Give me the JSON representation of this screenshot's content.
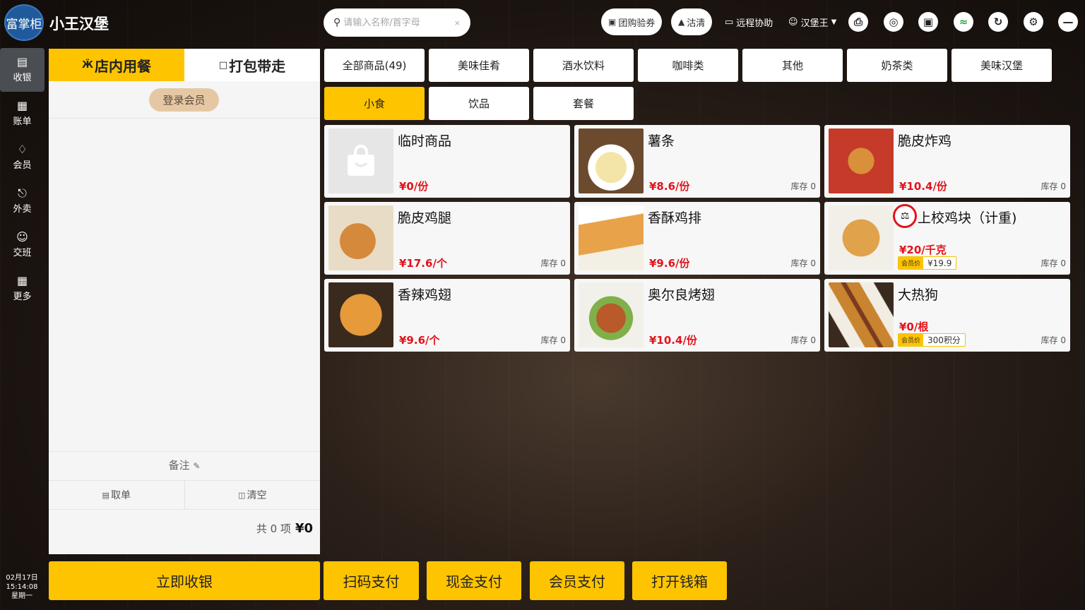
{
  "header": {
    "logo_text": "富掌柜",
    "shop_name": "小王汉堡",
    "search_placeholder": "请输入名称/首字母",
    "group_buy": "团购验券",
    "clean": "沽清",
    "remote": "远程协助",
    "user": "汉堡王"
  },
  "sidebar": {
    "items": [
      {
        "label": "收银",
        "icon": "cashier-icon"
      },
      {
        "label": "账单",
        "icon": "bill-icon"
      },
      {
        "label": "会员",
        "icon": "member-icon"
      },
      {
        "label": "外卖",
        "icon": "delivery-icon"
      },
      {
        "label": "交班",
        "icon": "shift-icon"
      },
      {
        "label": "更多",
        "icon": "more-icon"
      }
    ],
    "date": "02月17日",
    "time": "15:14:08",
    "weekday": "星期一"
  },
  "order": {
    "tab_dine": "店内用餐",
    "tab_takeout": "打包带走",
    "login_member": "登录会员",
    "note": "备注",
    "take_order": "取单",
    "clear": "清空",
    "count_text": "共 0 项",
    "total": "¥0"
  },
  "categories": {
    "row1": [
      "全部商品(49)",
      "美味佳肴",
      "酒水饮料",
      "咖啡类",
      "其他",
      "奶茶类",
      "美味汉堡"
    ],
    "row2": [
      "小食",
      "饮品",
      "套餐"
    ],
    "selected": "小食"
  },
  "products": [
    {
      "name": "临时商品",
      "price": "¥0/份",
      "stock": ""
    },
    {
      "name": "薯条",
      "price": "¥8.6/份",
      "stock": "库存 0"
    },
    {
      "name": "脆皮炸鸡",
      "price": "¥10.4/份",
      "stock": "库存 0"
    },
    {
      "name": "脆皮鸡腿",
      "price": "¥17.6/个",
      "stock": "库存 0"
    },
    {
      "name": "香酥鸡排",
      "price": "¥9.6/份",
      "stock": "库存 0"
    },
    {
      "name": "上校鸡块（计重)",
      "price": "¥20/千克",
      "stock": "库存 0",
      "member_label": "会员价",
      "member_price": "¥19.9"
    },
    {
      "name": "香辣鸡翅",
      "price": "¥9.6/个",
      "stock": "库存 0"
    },
    {
      "name": "奥尔良烤翅",
      "price": "¥10.4/份",
      "stock": "库存 0"
    },
    {
      "name": "大热狗",
      "price": "¥0/根",
      "stock": "库存 0",
      "member_label": "会员价",
      "member_price": "300积分"
    }
  ],
  "payments": {
    "checkout": "立即收银",
    "scan": "扫码支付",
    "cash": "现金支付",
    "member": "会员支付",
    "drawer": "打开钱箱"
  },
  "colors": {
    "accent": "#ffc400",
    "price": "#e2141c",
    "panel": "#f5f5f5"
  }
}
